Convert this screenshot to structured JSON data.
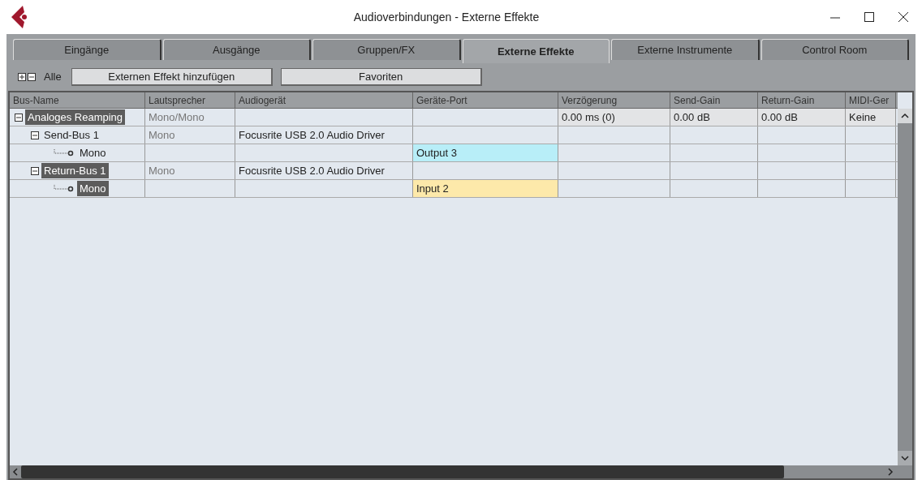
{
  "window": {
    "title": "Audioverbindungen - Externe Effekte"
  },
  "tabs": [
    {
      "label": "Eingänge",
      "selected": false
    },
    {
      "label": "Ausgänge",
      "selected": false
    },
    {
      "label": "Gruppen/FX",
      "selected": false
    },
    {
      "label": "Externe Effekte",
      "selected": true
    },
    {
      "label": "Externe Instrumente",
      "selected": false
    },
    {
      "label": "Control Room",
      "selected": false
    }
  ],
  "toolbar": {
    "all_label": "Alle",
    "buttons": [
      "Externen Effekt hinzufügen",
      "Favoriten"
    ]
  },
  "table": {
    "columns": [
      "Bus-Name",
      "Lautsprecher",
      "Audiogerät",
      "Geräte-Port",
      "Verzögerung",
      "Send-Gain",
      "Return-Gain",
      "MIDI-Ger"
    ],
    "rows": [
      {
        "name": "Analoges Reamping",
        "selected": true,
        "expanded": true,
        "speaker": "Mono/Mono",
        "delay": "0.00 ms (0)",
        "send_gain": "0.00 dB",
        "return_gain": "0.00 dB",
        "midi": "Keine",
        "children": [
          {
            "name": "Send-Bus 1",
            "selected": false,
            "expanded": true,
            "speaker": "Mono",
            "device": "Focusrite USB 2.0 Audio Driver",
            "children": [
              {
                "name": "Mono",
                "selected": false,
                "port": "Output 3",
                "color": "#b8eef8"
              }
            ]
          },
          {
            "name": "Return-Bus 1",
            "selected": true,
            "expanded": true,
            "speaker": "Mono",
            "device": "Focusrite USB 2.0 Audio Driver",
            "children": [
              {
                "name": "Mono",
                "selected": true,
                "port": "Input 2",
                "color": "#fde9aa"
              }
            ]
          }
        ]
      }
    ]
  }
}
